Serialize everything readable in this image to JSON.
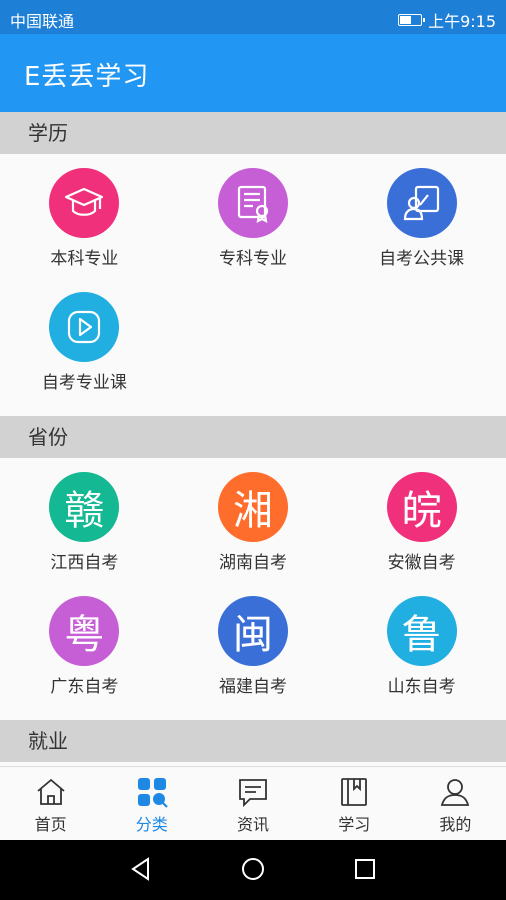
{
  "status": {
    "carrier": "中国联通",
    "time": "上午9:15",
    "battery_level": 0.6
  },
  "app": {
    "title": "E丢丢学习"
  },
  "sections": [
    {
      "title": "学历",
      "items": [
        {
          "label": "本科专业",
          "icon": "graduation-cap-icon",
          "color": "#f0307a"
        },
        {
          "label": "专科专业",
          "icon": "certificate-icon",
          "color": "#c65fd6"
        },
        {
          "label": "自考公共课",
          "icon": "teacher-board-icon",
          "color": "#3b6fd8"
        },
        {
          "label": "自考专业课",
          "icon": "play-icon",
          "color": "#21aee0"
        }
      ]
    },
    {
      "title": "省份",
      "items": [
        {
          "label": "江西自考",
          "glyph": "赣",
          "color": "#14b892"
        },
        {
          "label": "湖南自考",
          "glyph": "湘",
          "color": "#ff6d2c"
        },
        {
          "label": "安徽自考",
          "glyph": "皖",
          "color": "#f0307a"
        },
        {
          "label": "广东自考",
          "glyph": "粤",
          "color": "#c65fd6"
        },
        {
          "label": "福建自考",
          "glyph": "闽",
          "color": "#3b6fd8"
        },
        {
          "label": "山东自考",
          "glyph": "鲁",
          "color": "#21aee0"
        }
      ]
    },
    {
      "title": "就业",
      "items": [
        {
          "color": "#ff6d2c"
        },
        {
          "color": "#ffb300"
        },
        {
          "color": "#7cc243"
        }
      ]
    }
  ],
  "tabs": [
    {
      "label": "首页",
      "icon": "home-icon",
      "active": false
    },
    {
      "label": "分类",
      "icon": "category-icon",
      "active": true
    },
    {
      "label": "资讯",
      "icon": "message-icon",
      "active": false
    },
    {
      "label": "学习",
      "icon": "book-icon",
      "active": false
    },
    {
      "label": "我的",
      "icon": "user-icon",
      "active": false
    }
  ]
}
